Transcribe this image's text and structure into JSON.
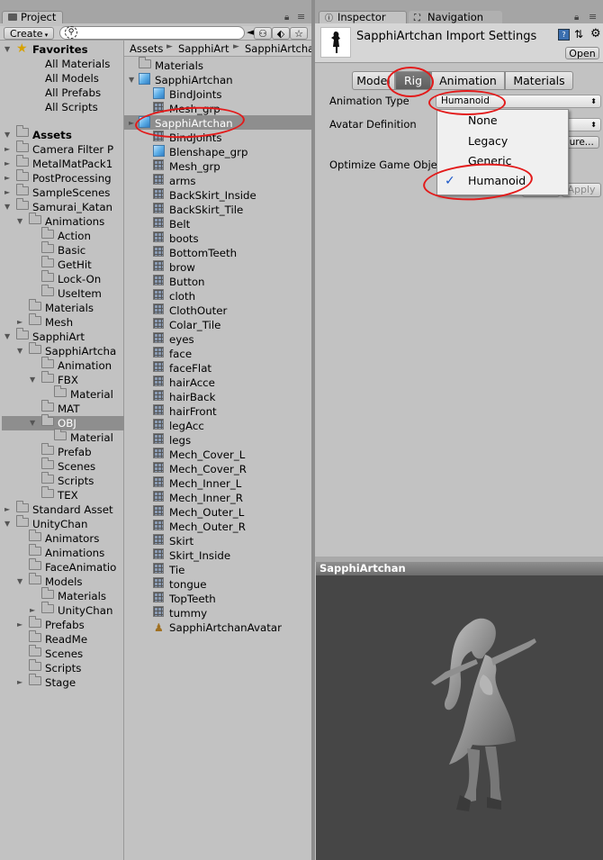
{
  "project_tab": {
    "label": "Project"
  },
  "project_toolbar": {
    "create_label": "Create",
    "search_placeholder": ""
  },
  "favorites": {
    "header": "Favorites",
    "items": [
      "All Materials",
      "All Models",
      "All Prefabs",
      "All Scripts"
    ]
  },
  "assets_tree": {
    "header": "Assets",
    "items": [
      "Camera Filter P",
      "MetalMatPack1",
      "PostProcessing",
      "SampleScenes",
      "Samurai_Katan",
      "Animations",
      "Action",
      "Basic",
      "GetHit",
      "Lock-On",
      "UseItem",
      "Materials",
      "Mesh",
      "SapphiArt",
      "SapphiArtcha",
      "Animation",
      "FBX",
      "Material",
      "MAT",
      "OBJ",
      "Material",
      "Prefab",
      "Scenes",
      "Scripts",
      "TEX",
      "Standard Asset",
      "UnityChan",
      "Animators",
      "Animations",
      "FaceAnimatio",
      "Models",
      "Materials",
      "UnityChan",
      "Prefabs",
      "ReadMe",
      "Scenes",
      "Scripts",
      "Stage"
    ]
  },
  "breadcrumb": [
    "Assets",
    "SapphiArt",
    "SapphiArtcha"
  ],
  "file_list": {
    "items": [
      "Materials",
      "SapphiArtchan",
      "BindJoints",
      "Mesh_grp",
      "SapphiArtchan",
      "BindJoints",
      "Blenshape_grp",
      "Mesh_grp",
      "arms",
      "BackSkirt_Inside",
      "BackSkirt_Tile",
      "Belt",
      "boots",
      "BottomTeeth",
      "brow",
      "Button",
      "cloth",
      "ClothOuter",
      "Colar_Tile",
      "eyes",
      "face",
      "faceFlat",
      "hairAcce",
      "hairBack",
      "hairFront",
      "legAcc",
      "legs",
      "Mech_Cover_L",
      "Mech_Cover_R",
      "Mech_Inner_L",
      "Mech_Inner_R",
      "Mech_Outer_L",
      "Mech_Outer_R",
      "Skirt",
      "Skirt_Inside",
      "Tie",
      "tongue",
      "TopTeeth",
      "tummy",
      "SapphiArtchanAvatar"
    ]
  },
  "inspector": {
    "tab_label": "Inspector",
    "navigation_tab_label": "Navigation",
    "title": "SapphiArtchan Import Settings",
    "open_label": "Open",
    "tabs": [
      "Model",
      "Rig",
      "Animation",
      "Materials"
    ],
    "animation_type_label": "Animation Type",
    "animation_type_value": "Humanoid",
    "avatar_definition_label": "Avatar Definition",
    "optimize_label": "Optimize Game Obje",
    "configure_label": "igure...",
    "apply_label": "Apply",
    "dropdown_options": [
      "None",
      "Legacy",
      "Generic",
      "Humanoid"
    ],
    "checkmark": "✓"
  },
  "preview": {
    "title": "SapphiArtchan"
  },
  "colors": {
    "selection": "#8e8e8e",
    "annotation": "#e31a1a",
    "preview_bg": "#464646"
  }
}
